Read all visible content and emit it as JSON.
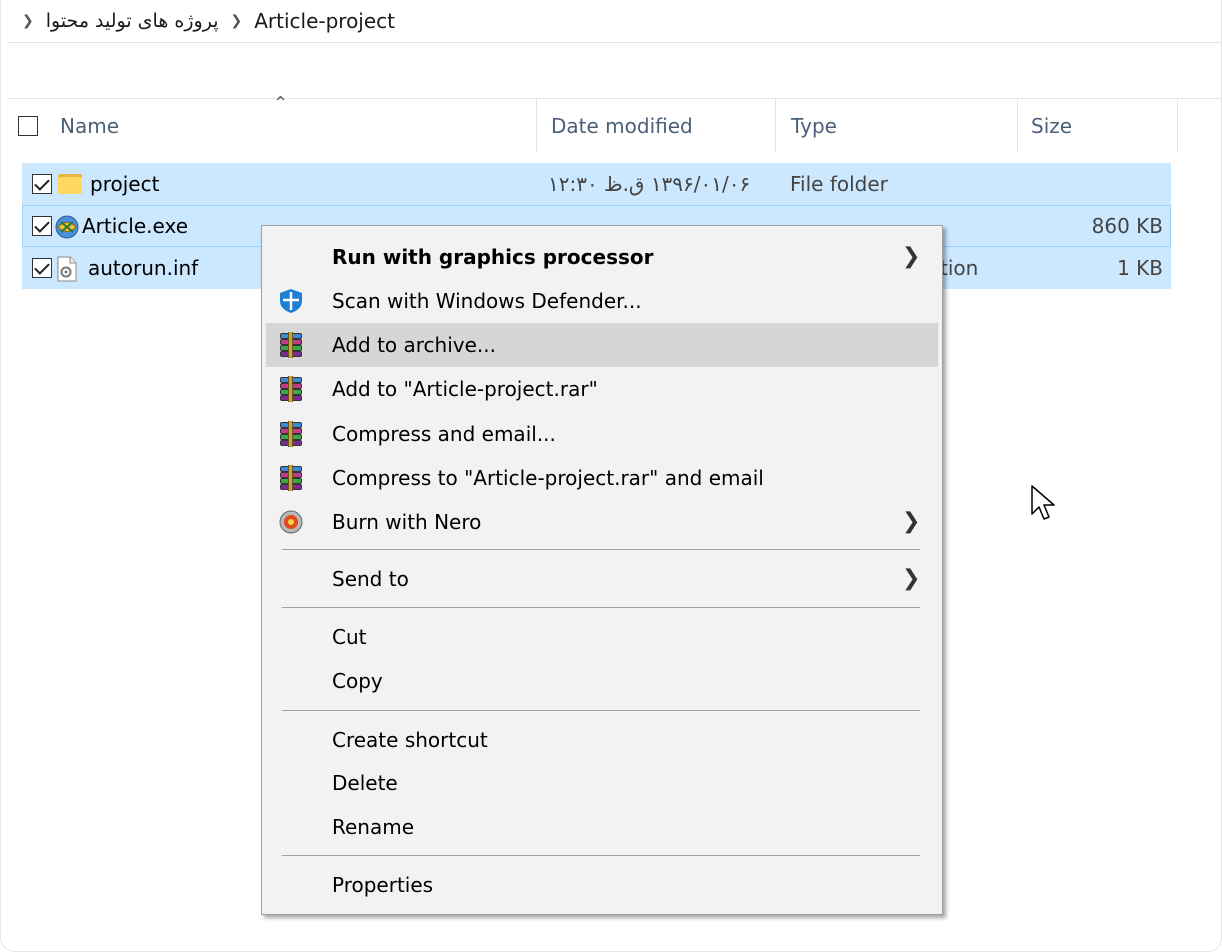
{
  "breadcrumb": {
    "items": [
      "پروژه های تولید محتوا",
      "Article-project"
    ]
  },
  "columns": {
    "name": "Name",
    "date_modified": "Date modified",
    "type": "Type",
    "size": "Size"
  },
  "files": [
    {
      "name": "project",
      "date": "۱۳۹۶/۰۱/۰۶ ق.ظ ۱۲:۳۰",
      "type": "File folder",
      "size": "",
      "icon": "folder-icon",
      "checked": true
    },
    {
      "name": "Article.exe",
      "date": "",
      "type": "",
      "size": "860 KB",
      "icon": "application-icon",
      "checked": true
    },
    {
      "name": "autorun.inf",
      "date": "",
      "type": "tion",
      "size": "1 KB",
      "icon": "settings-file-icon",
      "checked": true
    }
  ],
  "context_menu": {
    "items": [
      {
        "label": "Run with graphics processor",
        "bold": true,
        "submenu": true,
        "icon": ""
      },
      {
        "label": "Scan with Windows Defender...",
        "icon": "windows-defender-icon"
      },
      {
        "label": "Add to archive...",
        "icon": "winrar-icon",
        "highlighted": true
      },
      {
        "label": "Add to \"Article-project.rar\"",
        "icon": "winrar-icon"
      },
      {
        "label": "Compress and email...",
        "icon": "winrar-icon"
      },
      {
        "label": "Compress to \"Article-project.rar\" and email",
        "icon": "winrar-icon"
      },
      {
        "label": "Burn with Nero",
        "icon": "nero-icon",
        "submenu": true
      },
      {
        "label": "Send to",
        "submenu": true
      },
      {
        "label": "Cut"
      },
      {
        "label": "Copy"
      },
      {
        "label": "Create shortcut"
      },
      {
        "label": "Delete"
      },
      {
        "label": "Rename"
      },
      {
        "label": "Properties"
      }
    ]
  },
  "colors": {
    "selection": "#cce8ff",
    "selection_border": "#99d1ff",
    "menu_bg": "#f2f2f2",
    "menu_highlight": "#d6d6d6",
    "header_text": "#4c607a"
  }
}
